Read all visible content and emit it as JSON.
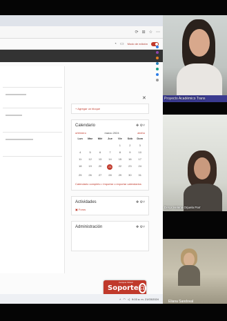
{
  "browser": {
    "edit_mode_label": "Modo de edición"
  },
  "sidebar": {
    "add_block_label": "+ Agregar un bloque",
    "calendar": {
      "title": "Calendario",
      "prev_label": "◂ febrero",
      "month_label": "marzo 2024",
      "next_label": "abril ▸",
      "days_of_week": [
        "Lun",
        "Mar",
        "Mié",
        "Jue",
        "Vie",
        "Sáb",
        "Dom"
      ],
      "weeks": [
        [
          "",
          "",
          "",
          "",
          "1",
          "2",
          "3"
        ],
        [
          "4",
          "5",
          "6",
          "7",
          "8",
          "9",
          "10"
        ],
        [
          "11",
          "12",
          "13",
          "14",
          "15",
          "16",
          "17"
        ],
        [
          "18",
          "19",
          "20",
          "21",
          "22",
          "23",
          "24"
        ],
        [
          "25",
          "26",
          "27",
          "28",
          "29",
          "30",
          "31"
        ]
      ],
      "today": "21",
      "full_link": "Calendario completo",
      "import_link": "Importar o exportar calendarios"
    },
    "activities": {
      "title": "Actividades",
      "link": "Foros"
    },
    "admin": {
      "title": "Administración"
    }
  },
  "soporte": {
    "label": "Soporte",
    "sublabel": "Campus Virtual"
  },
  "participants": [
    {
      "name": "Proyecto Académico Trans"
    },
    {
      "name": "Deryx Helena Orjuela Parr"
    },
    {
      "name": "Eliana Sandoval"
    }
  ],
  "taskbar": {
    "time": "9:03 a. m.",
    "date": "21/03/2024"
  },
  "colors": {
    "accent": "#c0392b",
    "name_tag": "#3b3b8f"
  }
}
